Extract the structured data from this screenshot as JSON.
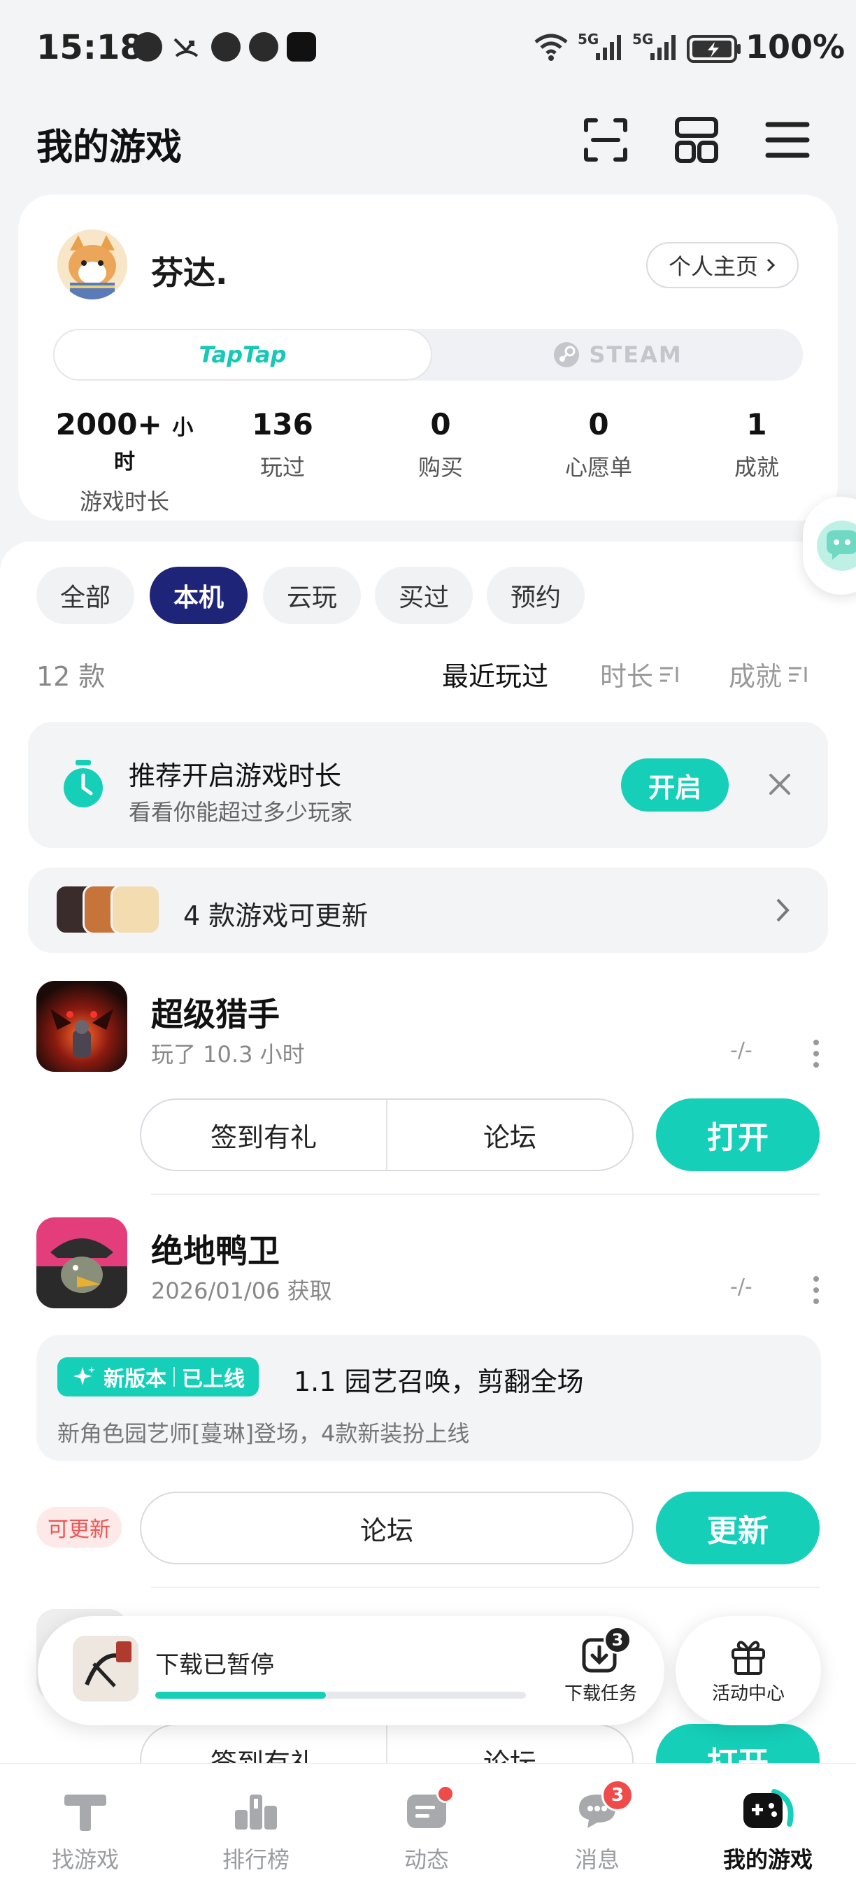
{
  "status_bar": {
    "time": "15:18",
    "signal_1": "5G",
    "signal_2": "5G",
    "battery": "100%"
  },
  "header": {
    "title": "我的游戏"
  },
  "profile": {
    "username": "芬达.",
    "home_label": "个人主页",
    "platform_tabs": [
      "TapTap",
      "STEAM"
    ],
    "stats": [
      {
        "value": "2000+",
        "unit": "小时",
        "label": "游戏时长"
      },
      {
        "value": "136",
        "unit": "",
        "label": "玩过"
      },
      {
        "value": "0",
        "unit": "",
        "label": "购买"
      },
      {
        "value": "0",
        "unit": "",
        "label": "心愿单"
      },
      {
        "value": "1",
        "unit": "",
        "label": "成就"
      }
    ]
  },
  "filters": [
    "全部",
    "本机",
    "云玩",
    "买过",
    "预约"
  ],
  "list_meta": {
    "count": "12 款",
    "sort_recent": "最近玩过",
    "sort_duration": "时长",
    "sort_achievement": "成就"
  },
  "recommend": {
    "title": "推荐开启游戏时长",
    "subtitle": "看看你能超过多少玩家",
    "button": "开启"
  },
  "updates_banner": {
    "text": "4 款游戏可更新"
  },
  "games": [
    {
      "name": "超级猎手",
      "sub": "玩了 10.3 小时",
      "dash": "-/-",
      "actions": [
        "签到有礼",
        "论坛"
      ],
      "primary": "打开"
    },
    {
      "name": "绝地鸭卫",
      "sub": "2026/01/06 获取",
      "dash": "-/-",
      "news_badge_1": "新版本",
      "news_badge_2": "已上线",
      "news_title": "1.1 园艺召唤，剪翻全场",
      "news_desc": "新角色园艺师[蔓琳]登场，4款新装扮上线",
      "tag": "可更新",
      "actions": [
        "论坛"
      ],
      "primary": "更新"
    },
    {
      "actions": [
        "签到有礼",
        "论坛"
      ],
      "primary": "打开"
    }
  ],
  "download_bar": {
    "title": "下载已暂停",
    "progress": 0.46,
    "task_label": "下载任务",
    "task_count": "3"
  },
  "activity": {
    "label": "活动中心"
  },
  "bottom_nav": [
    {
      "label": "找游戏"
    },
    {
      "label": "排行榜"
    },
    {
      "label": "动态"
    },
    {
      "label": "消息",
      "badge": "3"
    },
    {
      "label": "我的游戏"
    }
  ],
  "colors": {
    "accent": "#16cfb9",
    "filter_active": "#1e2478",
    "alert": "#f04b4b"
  }
}
